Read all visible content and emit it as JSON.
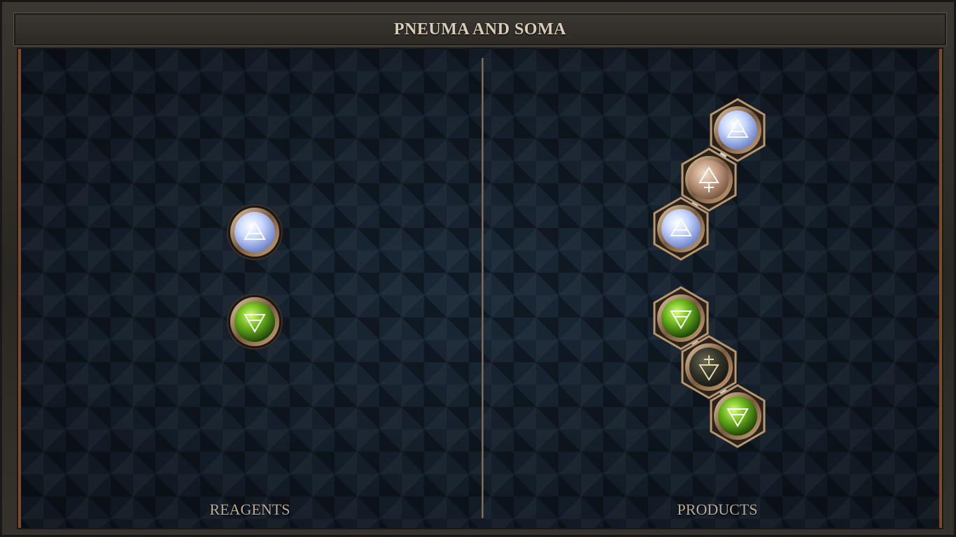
{
  "window": {
    "title": "PNEUMA AND SOMA"
  },
  "sections": {
    "reagents_label": "REAGENTS",
    "products_label": "PRODUCTS"
  },
  "colors": {
    "frame": "#2c2925",
    "board": "#0f1720",
    "copper_edge": "#7a4a2a",
    "air_orb": "#dfe8ff",
    "earth_orb": "#7fc22a",
    "salt_orb": "#c8a48a",
    "dark_orb": "#3a3a2e"
  },
  "reagents": [
    {
      "element": "air",
      "icon": "air-symbol-icon"
    },
    {
      "element": "earth",
      "icon": "earth-symbol-icon"
    }
  ],
  "products": [
    {
      "molecule": "air-pneuma-air",
      "atoms": [
        "air",
        "pneuma",
        "air"
      ]
    },
    {
      "molecule": "earth-soma-earth",
      "atoms": [
        "earth",
        "soma",
        "earth"
      ]
    }
  ]
}
